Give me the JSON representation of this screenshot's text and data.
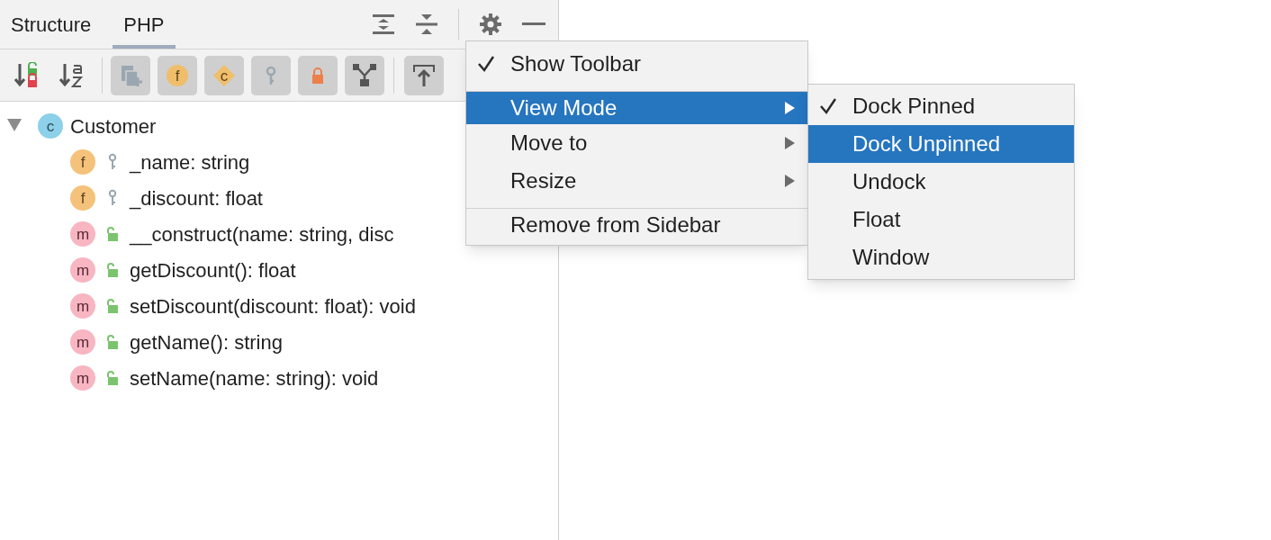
{
  "tabs": [
    {
      "label": "Structure",
      "selected": false
    },
    {
      "label": "PHP",
      "selected": true
    }
  ],
  "toolbar": {
    "toggles": [
      {
        "kind": "inherited",
        "selected": true
      },
      {
        "kind": "fields",
        "letter": "f",
        "selected": true
      },
      {
        "kind": "constants",
        "letter": "c",
        "selected": true
      },
      {
        "kind": "private",
        "selected": true
      },
      {
        "kind": "protected",
        "selected": true
      },
      {
        "kind": "traits",
        "selected": true
      },
      {
        "kind": "autoscroll",
        "selected": true
      }
    ]
  },
  "tree": {
    "label": "Customer",
    "badge": "c",
    "expanded": true,
    "children": [
      {
        "badge": "f",
        "kind": "private",
        "label": "_name: string"
      },
      {
        "badge": "f",
        "kind": "private",
        "label": "_discount: float"
      },
      {
        "badge": "m",
        "kind": "public",
        "label": "__construct(name: string, disc"
      },
      {
        "badge": "m",
        "kind": "public",
        "label": "getDiscount(): float"
      },
      {
        "badge": "m",
        "kind": "public",
        "label": "setDiscount(discount: float): void"
      },
      {
        "badge": "m",
        "kind": "public",
        "label": "getName(): string"
      },
      {
        "badge": "m",
        "kind": "public",
        "label": "setName(name: string): void"
      }
    ]
  },
  "menu": [
    {
      "label": "Show Toolbar",
      "checked": true,
      "selected": false,
      "submenu": false,
      "separator_before": false
    },
    {
      "label": "View Mode",
      "checked": false,
      "selected": true,
      "submenu": true,
      "separator_before": true
    },
    {
      "label": "Move to",
      "checked": false,
      "selected": false,
      "submenu": true,
      "separator_before": false
    },
    {
      "label": "Resize",
      "checked": false,
      "selected": false,
      "submenu": true,
      "separator_before": false
    },
    {
      "label": "Remove from Sidebar",
      "checked": false,
      "selected": false,
      "submenu": false,
      "separator_before": true
    }
  ],
  "submenu": [
    {
      "label": "Dock Pinned",
      "checked": true,
      "selected": false
    },
    {
      "label": "Dock Unpinned",
      "checked": false,
      "selected": true
    },
    {
      "label": "Undock",
      "checked": false,
      "selected": false
    },
    {
      "label": "Float",
      "checked": false,
      "selected": false
    },
    {
      "label": "Window",
      "checked": false,
      "selected": false
    }
  ]
}
